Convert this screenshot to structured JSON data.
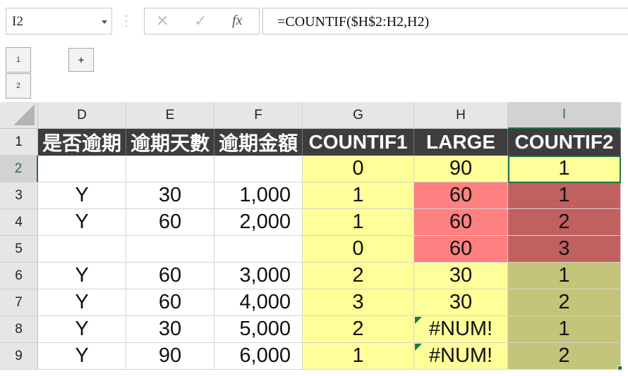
{
  "name_box": "I2",
  "formula_bar": {
    "cancel_icon": "close-x-icon",
    "enter_icon": "checkmark-icon",
    "fx_label": "fx",
    "formula": "=COUNTIF($H$2:H2,H2)"
  },
  "outline": {
    "level1": "1",
    "level2": "2",
    "expand": "+"
  },
  "columns": [
    "D",
    "E",
    "F",
    "G",
    "H",
    "I"
  ],
  "rows": [
    "1",
    "2",
    "3",
    "4",
    "5",
    "6",
    "7",
    "8",
    "9"
  ],
  "header_row": [
    "是否逾期",
    "逾期天數",
    "逾期金額",
    "COUNTIF1",
    "LARGE",
    "COUNTIF2"
  ],
  "data": [
    [
      "",
      "",
      "",
      "0",
      "90",
      "1"
    ],
    [
      "Y",
      "30",
      "1,000",
      "1",
      "60",
      "1"
    ],
    [
      "Y",
      "60",
      "2,000",
      "1",
      "60",
      "2"
    ],
    [
      "",
      "",
      "",
      "0",
      "60",
      "3"
    ],
    [
      "Y",
      "60",
      "3,000",
      "2",
      "30",
      "1"
    ],
    [
      "Y",
      "60",
      "4,000",
      "3",
      "30",
      "2"
    ],
    [
      "Y",
      "30",
      "5,000",
      "2",
      "#NUM!",
      "1"
    ],
    [
      "Y",
      "90",
      "6,000",
      "1",
      "#NUM!",
      "2"
    ]
  ],
  "selected_cell": "I2",
  "colors": {
    "header_fill": "#3d3d3d",
    "yellow_fill": "#ffff99",
    "red_fill": "#ff8080",
    "dark_red_fill": "#c0605f",
    "olive_fill": "#c4c47a",
    "selection": "#217346"
  }
}
